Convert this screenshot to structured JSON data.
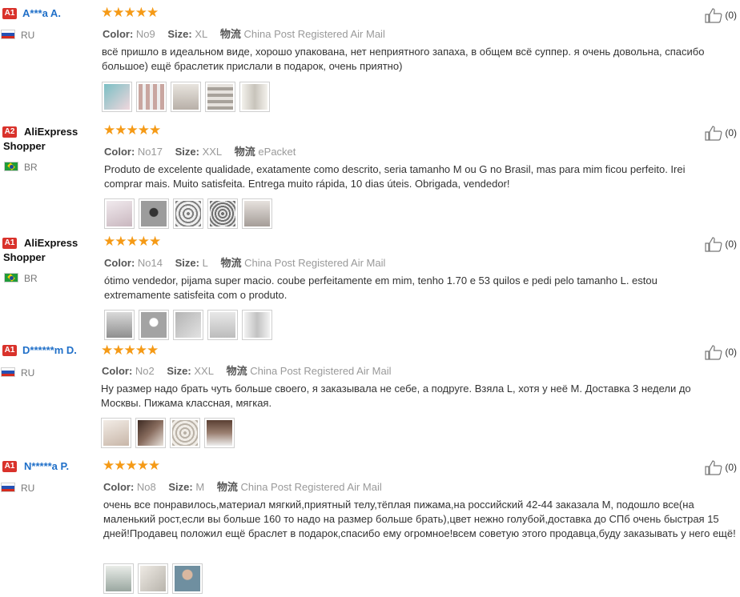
{
  "reviews": [
    {
      "badge": "A1",
      "name": "A***a A.",
      "name_style": "masked",
      "country": "RU",
      "flag": "ru",
      "rating": "★★★★★",
      "color_label": "Color:",
      "color": "No9",
      "size_label": "Size:",
      "size": "XL",
      "shipping_label": "物流",
      "shipping": "China Post Registered Air Mail",
      "text": "всё пришло в идеальном виде, хорошо упакована, нет неприятного запаха, в общем всё суппер. я очень довольна, спасибо большое) ещё браслетик прислали в подарок, очень приятно)",
      "helpful": "(0)",
      "photos": 5,
      "photo_colors": [
        "#7bbfc4",
        "#c9a6a0",
        "#b8b0a8",
        "#a8a29b",
        "#c8c4bb"
      ]
    },
    {
      "badge": "A2",
      "name": "AliExpress Shopper",
      "name_style": "plain",
      "country": "BR",
      "flag": "br",
      "rating": "★★★★★",
      "color_label": "Color:",
      "color": "No17",
      "size_label": "Size:",
      "size": "XXL",
      "shipping_label": "物流",
      "shipping": "ePacket",
      "text": "Produto de excelente qualidade, exatamente como descrito, seria tamanho M ou G no Brasil, mas para mim ficou perfeito. Irei comprar mais. Muito satisfeita. Entrega muito rápida, 10 dias úteis. Obrigada, vendedor!",
      "helpful": "(0)",
      "photos": 5,
      "photo_colors": [
        "#c9b7bf",
        "#9c9c9c",
        "#7e7e7e",
        "#6f6f6f",
        "#a59d98"
      ]
    },
    {
      "badge": "A1",
      "name": "AliExpress Shopper",
      "name_style": "plain",
      "country": "BR",
      "flag": "br",
      "rating": "★★★★★",
      "color_label": "Color:",
      "color": "No14",
      "size_label": "Size:",
      "size": "L",
      "shipping_label": "物流",
      "shipping": "China Post Registered Air Mail",
      "text": "ótimo vendedor, pijama super macio. coube perfeitamente em mim, tenho 1.70 e 53 quilos e pedi pelo tamanho L. estou extremamente satisfeita com o produto.",
      "helpful": "(0)",
      "photos": 5,
      "photo_colors": [
        "#8f8f8f",
        "#a3a3a3",
        "#b4b4b4",
        "#bcbcbc",
        "#c2c2c2"
      ]
    },
    {
      "badge": "A1",
      "name": "D******m D.",
      "name_style": "masked",
      "country": "RU",
      "flag": "ru",
      "rating": "★★★★★",
      "color_label": "Color:",
      "color": "No2",
      "size_label": "Size:",
      "size": "XXL",
      "shipping_label": "物流",
      "shipping": "China Post Registered Air Mail",
      "text": "Ну размер надо брать чуть больше своего, я заказывала не себе, а подруге. Взяла L, хотя у неё M. Доставка 3 недели до Москвы. Пижама классная, мягкая.",
      "helpful": "(0)",
      "photos": 4,
      "photo_colors": [
        "#c8b6a8",
        "#8a6e60",
        "#b9b1a6",
        "#9a7f70"
      ]
    },
    {
      "badge": "A1",
      "name": "N*****a P.",
      "name_style": "masked",
      "country": "RU",
      "flag": "ru",
      "rating": "★★★★★",
      "color_label": "Color:",
      "color": "No8",
      "size_label": "Size:",
      "size": "M",
      "shipping_label": "物流",
      "shipping": "China Post Registered Air Mail",
      "text": "очень все понравилось,материал мягкий,приятный телу,тёплая пижама,на российский 42-44 заказала М, подошло все(на маленький рост,если вы больше 160 то надо на размер больше брать),цвет нежно голубой,доставка до СПб очень быстрая 15 дней!Продавец положил ещё браслет в подарок,спасибо ему огромное!всем советую этого продавца,буду заказывать у него ещё!",
      "helpful": "(0)",
      "photos": 3,
      "photo_colors": [
        "#9aa7a0",
        "#b8b4ac",
        "#6f8fa0"
      ]
    }
  ]
}
